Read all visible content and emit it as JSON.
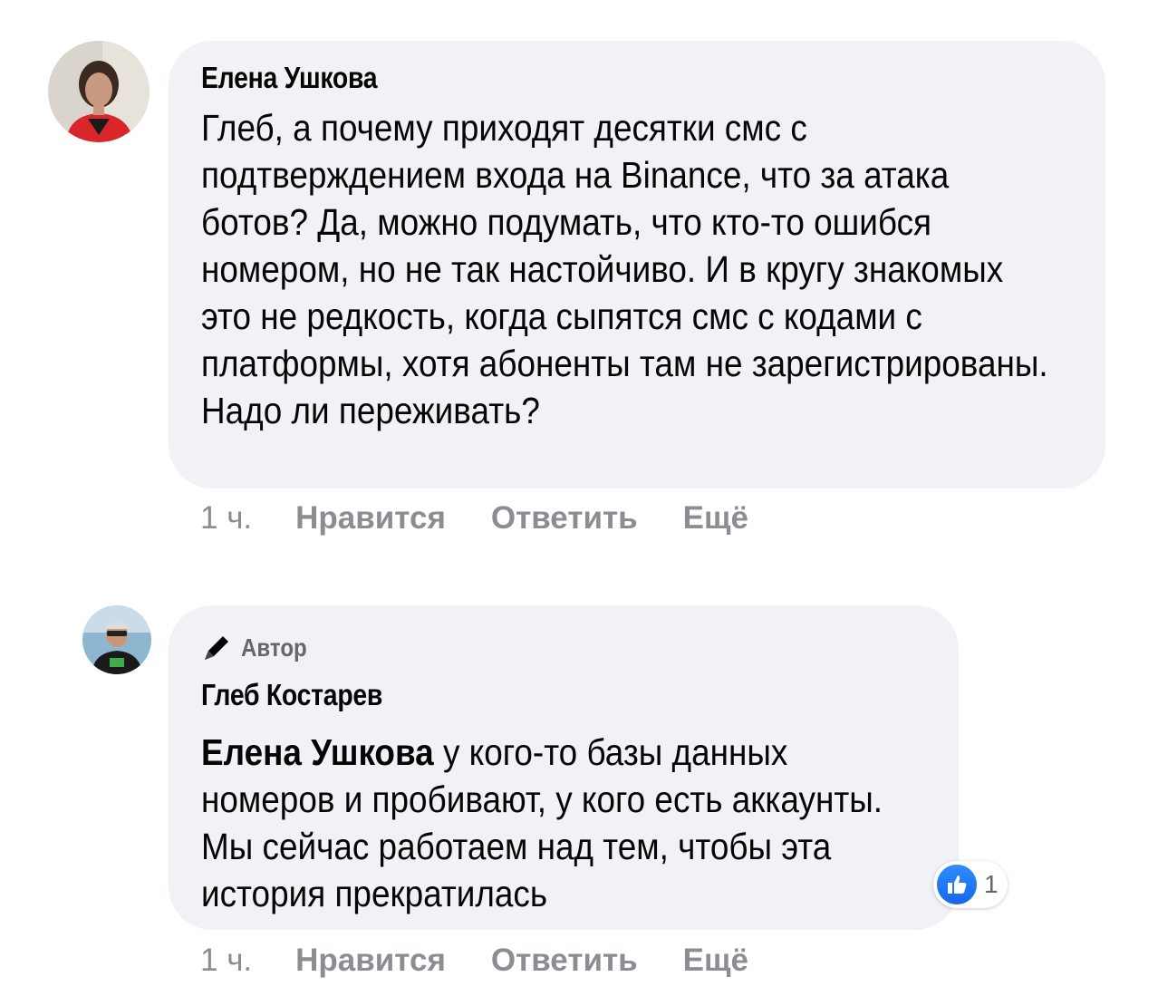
{
  "comments": [
    {
      "author": "Елена Ушкова",
      "text": "Глеб, а почему приходят десятки смс с подтверждением входа на Binance, что за атака ботов? Да, можно подумать, что кто-то ошибся номером, но не так настойчиво. И в кругу знакомых это не редкость, когда сыпятся смс с кодами с платформы, хотя абоненты там не зарегистрированы. Надо ли переживать?",
      "time": "1 ч.",
      "like_label": "Нравится",
      "reply_label": "Ответить",
      "more_label": "Ещё",
      "avatar_icon": "woman-avatar"
    },
    {
      "badge": "Автор",
      "badge_icon": "pen-icon",
      "author": "Глеб Костарев",
      "mention": "Елена Ушкова",
      "text": " у кого-то базы данных номеров и пробивают, у кого есть аккаунты. Мы сейчас работаем над тем, чтобы эта история прекратилась",
      "time": "1 ч.",
      "like_label": "Нравится",
      "reply_label": "Ответить",
      "more_label": "Ещё",
      "reaction_count": "1",
      "reaction_icon": "like-icon",
      "avatar_icon": "man-avatar"
    }
  ]
}
